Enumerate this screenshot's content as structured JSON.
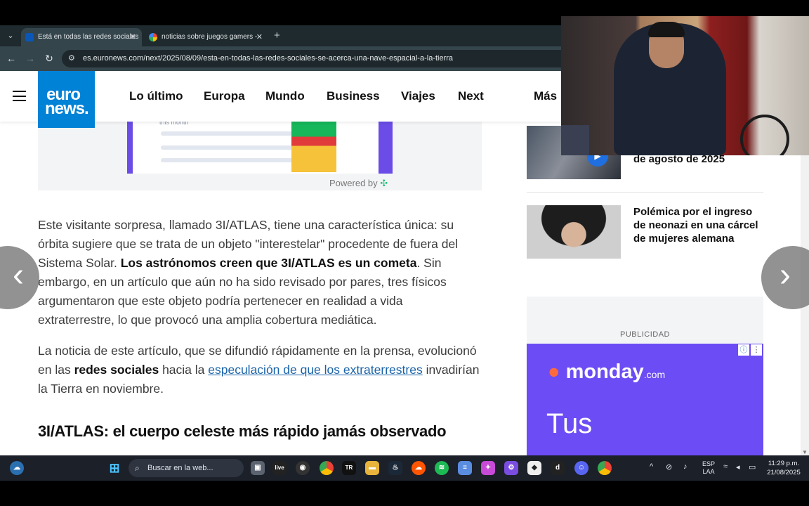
{
  "browser": {
    "tabs": [
      {
        "title": "Está en todas las redes sociales",
        "active": true,
        "favicon": "euronews-favicon"
      },
      {
        "title": "noticias sobre juegos gamers -",
        "active": false,
        "favicon": "google-favicon"
      }
    ],
    "url": "es.euronews.com/next/2025/08/09/esta-en-todas-las-redes-sociales-se-acerca-una-nave-espacial-a-la-tierra"
  },
  "site": {
    "logo_line1": "euro",
    "logo_line2": "news.",
    "nav": [
      "Lo último",
      "Europa",
      "Mundo",
      "Business",
      "Viajes",
      "Next",
      "Más"
    ]
  },
  "article": {
    "ad_month": "this month",
    "powered_by": "Powered by",
    "p1_a": "Este visitante sorpresa, llamado 3I/ATLAS, tiene una característica única: su órbita sugiere que se trata de un objeto \"interestelar\" procedente de fuera del Sistema Solar. ",
    "p1_bold": "Los astrónomos creen que 3I/ATLAS es un cometa",
    "p1_b": ". Sin embargo, en un artículo que aún no ha sido revisado por pares, tres físicos argumentaron que este objeto podría pertenecer en realidad a vida extraterrestre, lo que provocó una amplia cobertura mediática.",
    "p2_a": "La noticia de este artículo, que se difundió rápidamente en la prensa, evolucionó en las ",
    "p2_bold": "redes sociales",
    "p2_b": " hacia la ",
    "p2_link": "especulación de que los extraterrestres",
    "p2_c": " invadirían la Tierra en noviembre.",
    "heading": "3I/ATLAS: el cuerpo celeste más rápido jamás observado"
  },
  "sidebar": {
    "item1_title": "de agosto de 2025",
    "item2_title": "Polémica por el ingreso de neonazi en una cárcel de mujeres alemana",
    "ad_label": "PUBLICIDAD",
    "ad_brand": "monday",
    "ad_brand_suffix": ".com",
    "ad_text": "Tus"
  },
  "taskbar": {
    "search_placeholder": "Buscar en la web...",
    "lang_line1": "ESP",
    "lang_line2": "LAA",
    "time": "11:29 p.m.",
    "date": "21/08/2025",
    "live_label": "live",
    "tr_label": "TR",
    "d_label": "d"
  },
  "colors": {
    "brand": "#0082d6",
    "link": "#1a63a8",
    "monday_bg": "#6c4cf4"
  }
}
